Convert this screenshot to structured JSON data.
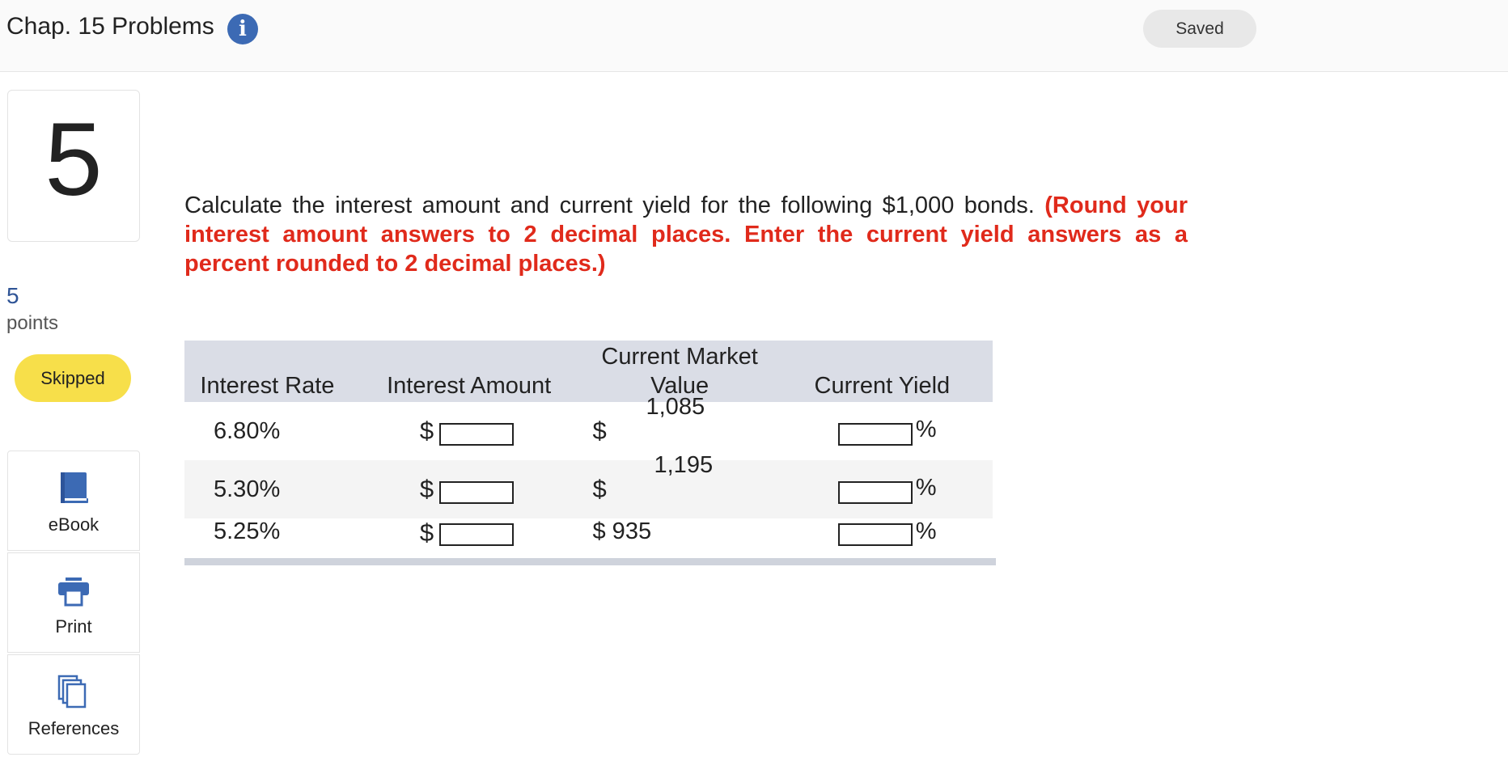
{
  "header": {
    "title": "Chap. 15 Problems",
    "info_icon": "info-icon",
    "saved_label": "Saved"
  },
  "sidebar": {
    "question_number": "5",
    "points_value": "5",
    "points_label": "points",
    "status_label": "Skipped",
    "tools": [
      {
        "label": "eBook",
        "icon": "book-icon"
      },
      {
        "label": "Print",
        "icon": "printer-icon"
      },
      {
        "label": "References",
        "icon": "copy-icon"
      }
    ]
  },
  "question": {
    "text": "Calculate the interest amount and current yield for the following $1,000 bonds.",
    "instruction": "(Round your interest amount answers to 2 decimal places. Enter the current yield answers as a percent rounded to 2 decimal places.)"
  },
  "table": {
    "headers": [
      "Interest Rate",
      "Interest Amount",
      "Current Market Value",
      "Current Yield"
    ],
    "currency_symbol": "$",
    "percent_symbol": "%",
    "rows": [
      {
        "rate": "6.80%",
        "market_value": "1,085",
        "interest_amount": "",
        "current_yield": ""
      },
      {
        "rate": "5.30%",
        "market_value": "1,195",
        "interest_amount": "",
        "current_yield": ""
      },
      {
        "rate": "5.25%",
        "market_value": "$ 935",
        "interest_amount": "",
        "current_yield": ""
      }
    ]
  },
  "colors": {
    "accent_blue": "#3c6ab4",
    "instruction_red": "#e02a1b",
    "skipped_yellow": "#f7df4a",
    "table_header_bg": "#dadde6"
  }
}
